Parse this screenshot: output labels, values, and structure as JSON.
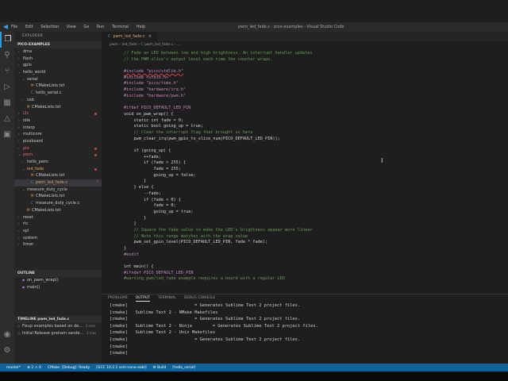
{
  "window": {
    "title": "pwm_led_fade.c - pico-examples - Visual Studio Code",
    "menu": [
      "File",
      "Edit",
      "Selection",
      "View",
      "Go",
      "Run",
      "Terminal",
      "Help"
    ]
  },
  "sidebar": {
    "header": "EXPLORER",
    "section": "PICO-EXAMPLES",
    "tree": [
      {
        "label": "dma",
        "kind": "folder",
        "depth": 1
      },
      {
        "label": "flash",
        "kind": "folder",
        "depth": 1
      },
      {
        "label": "gpio",
        "kind": "folder",
        "depth": 1
      },
      {
        "label": "hello_world",
        "kind": "folder-open",
        "depth": 1
      },
      {
        "label": "serial",
        "kind": "folder-open",
        "depth": 2
      },
      {
        "label": "CMakeLists.txt",
        "kind": "cmake",
        "depth": 3
      },
      {
        "label": "hello_serial.c",
        "kind": "c",
        "depth": 3
      },
      {
        "label": "usb",
        "kind": "folder",
        "depth": 2
      },
      {
        "label": "CMakeLists.txt",
        "kind": "cmake",
        "depth": 2
      },
      {
        "label": "i2c",
        "kind": "folder",
        "depth": 1,
        "state": "red",
        "dot": true
      },
      {
        "label": "idle",
        "kind": "folder",
        "depth": 1
      },
      {
        "label": "interp",
        "kind": "folder",
        "depth": 1
      },
      {
        "label": "multicore",
        "kind": "folder",
        "depth": 1
      },
      {
        "label": "picoboard",
        "kind": "folder",
        "depth": 1
      },
      {
        "label": "pio",
        "kind": "folder",
        "depth": 1,
        "state": "red",
        "dot": true
      },
      {
        "label": "pwm",
        "kind": "folder-open",
        "depth": 1,
        "state": "red",
        "dot": true
      },
      {
        "label": "hello_pwm",
        "kind": "folder",
        "depth": 2
      },
      {
        "label": "led_fade",
        "kind": "folder-open",
        "depth": 2,
        "state": "orange",
        "dot": true
      },
      {
        "label": "CMakeLists.txt",
        "kind": "cmake",
        "depth": 3
      },
      {
        "label": "pwm_led_fade.c",
        "kind": "c",
        "depth": 3,
        "state": "orange",
        "selected": true,
        "badge": "2"
      },
      {
        "label": "measure_duty_cycle",
        "kind": "folder-open",
        "depth": 2
      },
      {
        "label": "CMakeLists.txt",
        "kind": "cmake",
        "depth": 3
      },
      {
        "label": "measure_duty_cycle.c",
        "kind": "c",
        "depth": 3
      },
      {
        "label": "CMakeLists.txt",
        "kind": "cmake",
        "depth": 2
      },
      {
        "label": "reset",
        "kind": "folder",
        "depth": 1
      },
      {
        "label": "rtc",
        "kind": "folder",
        "depth": 1
      },
      {
        "label": "spi",
        "kind": "folder",
        "depth": 1
      },
      {
        "label": "system",
        "kind": "folder",
        "depth": 1
      },
      {
        "label": "timer",
        "kind": "folder",
        "depth": 1
      }
    ],
    "outline": {
      "header": "OUTLINE",
      "items": [
        "on_pwm_wrap()",
        "main()"
      ]
    },
    "timeline": {
      "header": "TIMELINE  pwm_led_fade.c",
      "items": [
        {
          "text": "Fixup examples based on de...",
          "time": "2 mos"
        },
        {
          "text": "Initial Release  graham sande...",
          "time": "3 mos"
        }
      ]
    }
  },
  "editor": {
    "tab": {
      "label": "pwm_led_fade.c",
      "close": "×"
    },
    "breadcrumb": [
      "pwm",
      "led_fade",
      "pwm_led_fade.c",
      "..."
    ],
    "lines": [
      {
        "n": "",
        "t": "// Fade an LED between low and high brightness. An interrupt handler updates",
        "k": "comment"
      },
      {
        "n": "",
        "t": "// the PWM slice's output level each time the counter wraps.",
        "k": "comment"
      },
      {
        "n": "",
        "t": "",
        "k": ""
      },
      {
        "n": "",
        "t": "#include \"pico/stdlib.h\"",
        "k": "err"
      },
      {
        "n": "",
        "t": "#include <stdio.h>",
        "k": "inc"
      },
      {
        "n": "",
        "t": "#include \"pico/time.h\"",
        "k": "inc"
      },
      {
        "n": "",
        "t": "#include \"hardware/irq.h\"",
        "k": "inc"
      },
      {
        "n": "",
        "t": "#include \"hardware/pwm.h\"",
        "k": "inc"
      },
      {
        "n": "",
        "t": "",
        "k": ""
      },
      {
        "n": "",
        "t": "#ifdef PICO_DEFAULT_LED_PIN",
        "k": "inc"
      },
      {
        "n": "",
        "t": "void on_pwm_wrap() {",
        "k": ""
      },
      {
        "n": "",
        "t": "    static int fade = 0;",
        "k": ""
      },
      {
        "n": "",
        "t": "    static bool going_up = true;",
        "k": ""
      },
      {
        "n": "",
        "t": "    // Clear the interrupt flag that brought us here",
        "k": "comment"
      },
      {
        "n": "",
        "t": "    pwm_clear_irq(pwm_gpio_to_slice_num(PICO_DEFAULT_LED_PIN));",
        "k": ""
      },
      {
        "n": "",
        "t": "",
        "k": ""
      },
      {
        "n": "",
        "t": "    if (going_up) {",
        "k": ""
      },
      {
        "n": "",
        "t": "        ++fade;",
        "k": ""
      },
      {
        "n": "",
        "t": "        if (fade > 255) {",
        "k": ""
      },
      {
        "n": "",
        "t": "            fade = 255;",
        "k": ""
      },
      {
        "n": "",
        "t": "            going_up = false;",
        "k": ""
      },
      {
        "n": "",
        "t": "        }",
        "k": ""
      },
      {
        "n": "",
        "t": "    } else {",
        "k": ""
      },
      {
        "n": "",
        "t": "        --fade;",
        "k": ""
      },
      {
        "n": "",
        "t": "        if (fade < 0) {",
        "k": ""
      },
      {
        "n": "",
        "t": "            fade = 0;",
        "k": ""
      },
      {
        "n": "",
        "t": "            going_up = true;",
        "k": ""
      },
      {
        "n": "",
        "t": "        }",
        "k": ""
      },
      {
        "n": "",
        "t": "    }",
        "k": ""
      },
      {
        "n": "",
        "t": "    // Square the fade value to make the LED's brightness appear more linear",
        "k": "comment"
      },
      {
        "n": "",
        "t": "    // Note this range matches with the wrap value",
        "k": "comment"
      },
      {
        "n": "",
        "t": "    pwm_set_gpio_level(PICO_DEFAULT_LED_PIN, fade * fade);",
        "k": ""
      },
      {
        "n": "",
        "t": "}",
        "k": ""
      },
      {
        "n": "",
        "t": "#endif",
        "k": "inc"
      },
      {
        "n": "",
        "t": "",
        "k": ""
      },
      {
        "n": "",
        "t": "int main() {",
        "k": ""
      },
      {
        "n": "",
        "t": "#ifndef PICO_DEFAULT_LED_PIN",
        "k": "inc"
      },
      {
        "n": "",
        "t": "#warning pwm/led_fade example requires a board with a regular LED",
        "k": "comment"
      }
    ]
  },
  "panel": {
    "tabs": [
      "PROBLEMS",
      "OUTPUT",
      "TERMINAL",
      "DEBUG CONSOLE"
    ],
    "active_tab": "OUTPUT",
    "output": [
      "[cmake]                          = Generates Sublime Text 2 project files.",
      "[cmake]   Sublime Text 2 - NMake Makefiles",
      "[cmake]                          = Generates Sublime Text 2 project files.",
      "[cmake]   Sublime Text 2 - Ninja        = Generates Sublime Text 2 project files.",
      "[cmake]   Sublime Text 2 - Unix Makefiles",
      "[cmake]                          = Generates Sublime Text 2 project files.",
      "[cmake]",
      "[cmake]"
    ]
  },
  "status": {
    "items": [
      "master*",
      "⊗ 2 ⚠ 0",
      "CMake: [Debug]: Ready",
      "[GCC 10.2.1 arm-none-eabi]",
      "⚙ Build",
      "[hello_serial]"
    ]
  },
  "colors": {
    "accent": "#0e639c",
    "modified": "#e5a05a",
    "error": "#c94a4a"
  }
}
